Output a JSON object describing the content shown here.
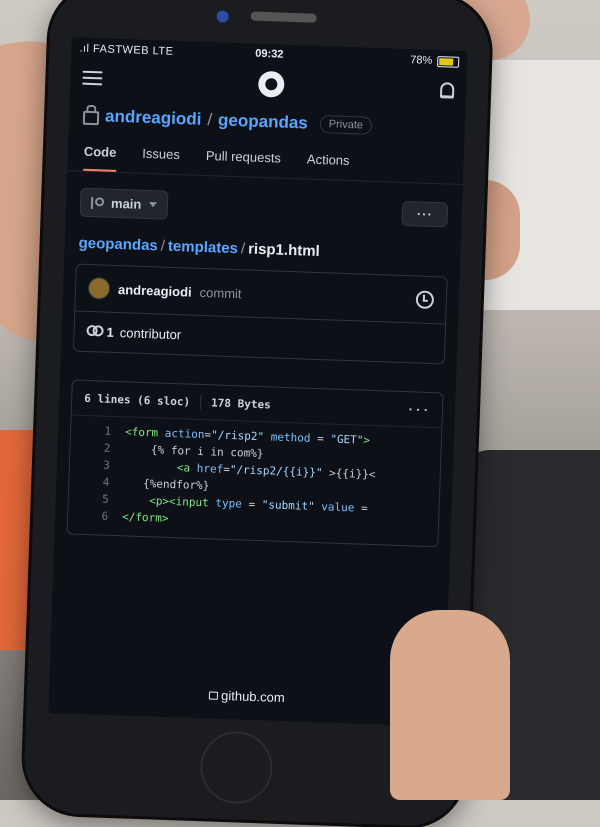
{
  "status": {
    "carrier": ".ıl FASTWEB LTE",
    "time": "09:32",
    "battery": "78%",
    "battery_fraction": 0.78
  },
  "repo": {
    "owner": "andreagiodi",
    "separator": "/",
    "name": "geopandas",
    "visibility": "Private"
  },
  "tabs": [
    {
      "label": "Code",
      "active": true
    },
    {
      "label": "Issues",
      "active": false
    },
    {
      "label": "Pull requests",
      "active": false
    },
    {
      "label": "Actions",
      "active": false
    }
  ],
  "branch": {
    "label": "main"
  },
  "more_label": "···",
  "breadcrumb": {
    "repo": "geopandas",
    "folder": "templates",
    "file": "risp1.html",
    "sep": "/"
  },
  "commit": {
    "author": "andreagiodi",
    "message": "commit"
  },
  "contributors": {
    "count": "1",
    "label": "contributor"
  },
  "file_info": {
    "lines": "6 lines (6 sloc)",
    "size": "178 Bytes"
  },
  "code_lines": [
    [
      {
        "t": "tag",
        "s": "<form "
      },
      {
        "t": "attr",
        "s": "action"
      },
      {
        "t": "txt",
        "s": "="
      },
      {
        "t": "str",
        "s": "\"/risp2\""
      },
      {
        "t": "txt",
        "s": " "
      },
      {
        "t": "attr",
        "s": "method"
      },
      {
        "t": "txt",
        "s": " = "
      },
      {
        "t": "str",
        "s": "\"GET\""
      },
      {
        "t": "tag",
        "s": ">"
      }
    ],
    [
      {
        "t": "txt",
        "s": "    {% for i in com%}"
      }
    ],
    [
      {
        "t": "txt",
        "s": "        "
      },
      {
        "t": "tag",
        "s": "<a "
      },
      {
        "t": "attr",
        "s": "href"
      },
      {
        "t": "txt",
        "s": "="
      },
      {
        "t": "str",
        "s": "\"/risp2/{{i}}\""
      },
      {
        "t": "txt",
        "s": " >{{i}}<"
      }
    ],
    [
      {
        "t": "txt",
        "s": "   {%endfor%}"
      }
    ],
    [
      {
        "t": "txt",
        "s": "    "
      },
      {
        "t": "tag",
        "s": "<p><input "
      },
      {
        "t": "attr",
        "s": "type"
      },
      {
        "t": "txt",
        "s": " = "
      },
      {
        "t": "str",
        "s": "\"submit\""
      },
      {
        "t": "txt",
        "s": " "
      },
      {
        "t": "attr",
        "s": "value"
      },
      {
        "t": "txt",
        "s": " ="
      }
    ],
    [
      {
        "t": "tag",
        "s": "</form>"
      }
    ]
  ],
  "url": "github.com",
  "colors": {
    "accent_link": "#58a6ff",
    "tab_underline": "#f78166",
    "background": "#0d1117",
    "battery": "#e3c81b"
  }
}
